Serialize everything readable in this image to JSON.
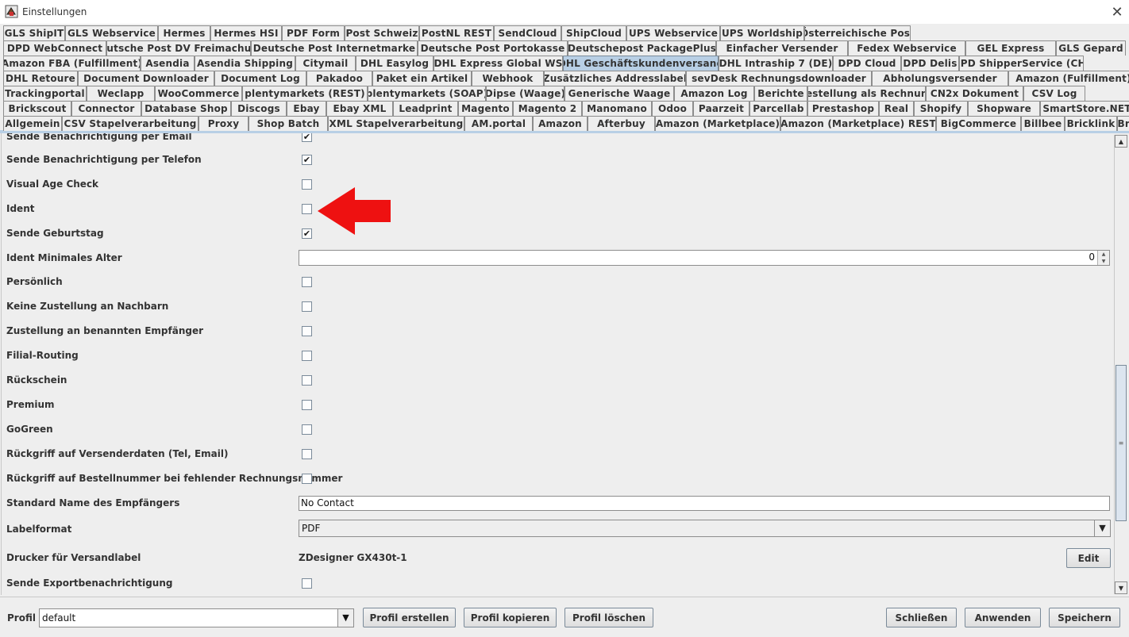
{
  "window": {
    "title": "Einstellungen",
    "close_glyph": "✕"
  },
  "tab_rows": [
    [
      "GLS ShipIT",
      "GLS Webservice",
      "Hermes",
      "Hermes HSI",
      "PDF Form",
      "Post Schweiz",
      "PostNL REST",
      "SendCloud",
      "ShipCloud",
      "UPS Webservice",
      "UPS Worldship",
      "Österreichische Post"
    ],
    [
      "DPD WebConnect",
      "Deutsche Post DV Freimachung",
      "Deutsche Post Internetmarke",
      "Deutsche Post Portokasse",
      "Deutschepost PackagePlus",
      "Einfacher Versender",
      "Fedex Webservice",
      "GEL Express",
      "GLS Gepard"
    ],
    [
      "Amazon FBA (Fulfillment)",
      "Asendia",
      "Asendia Shipping",
      "Citymail",
      "DHL Easylog",
      "DHL Express Global WS",
      "DHL Geschäftskundenversand",
      "DHL Intraship 7 (DE)",
      "DPD Cloud",
      "DPD Delis",
      "DPD ShipperService (CH)"
    ],
    [
      "DHL Retoure",
      "Document Downloader",
      "Document Log",
      "Pakadoo",
      "Paket ein Artikel",
      "Webhook",
      "Zusätzliches Addresslabel",
      "sevDesk Rechnungsdownloader",
      "Abholungsversender",
      "Amazon (Fulfillment)"
    ],
    [
      "Trackingportal",
      "Weclapp",
      "WooCommerce",
      "plentymarkets (REST)",
      "plentymarkets (SOAP)",
      "Dipse (Waage)",
      "Generische Waage",
      "Amazon Log",
      "Berichte",
      "Bestellung als Rechnung",
      "CN2x Dokument",
      "CSV Log"
    ],
    [
      "Brickscout",
      "Connector",
      "Database Shop",
      "Discogs",
      "Ebay",
      "Ebay XML",
      "Leadprint",
      "Magento",
      "Magento 2",
      "Manomano",
      "Odoo",
      "Paarzeit",
      "Parcellab",
      "Prestashop",
      "Real",
      "Shopify",
      "Shopware",
      "SmartStore.NET"
    ],
    [
      "Allgemein",
      "CSV Stapelverarbeitung",
      "Proxy",
      "Shop Batch",
      "XML Stapelverarbeitung",
      "AM.portal",
      "Amazon",
      "Afterbuy",
      "Amazon (Marketplace)",
      "Amazon (Marketplace) REST",
      "BigCommerce",
      "Billbee",
      "Bricklink",
      "Brickowl"
    ]
  ],
  "selected_tab": "DHL Geschäftskundenversand",
  "settings": {
    "r0": {
      "label": "Sende Benachrichtigung per Email",
      "checked": true
    },
    "r1": {
      "label": "Sende Benachrichtigung per Telefon",
      "checked": true
    },
    "r2": {
      "label": "Visual Age Check",
      "checked": false
    },
    "r3": {
      "label": "Ident",
      "checked": false
    },
    "r4": {
      "label": "Sende Geburtstag",
      "checked": true
    },
    "r5": {
      "label": "Ident Minimales Alter",
      "value": "0"
    },
    "r6": {
      "label": "Persönlich",
      "checked": false
    },
    "r7": {
      "label": "Keine Zustellung an Nachbarn",
      "checked": false
    },
    "r8": {
      "label": "Zustellung an benannten Empfänger",
      "checked": false
    },
    "r9": {
      "label": "Filial-Routing",
      "checked": false
    },
    "r10": {
      "label": "Rückschein",
      "checked": false
    },
    "r11": {
      "label": "Premium",
      "checked": false
    },
    "r12": {
      "label": "GoGreen",
      "checked": false
    },
    "r13": {
      "label": "Rückgriff auf Versenderdaten (Tel, Email)",
      "checked": false
    },
    "r14": {
      "label": "Rückgriff auf Bestellnummer bei fehlender Rechnungsnummer",
      "checked": false
    },
    "r15": {
      "label": "Standard Name des Empfängers",
      "value": "No Contact"
    },
    "r16": {
      "label": "Labelformat",
      "value": "PDF"
    },
    "r17": {
      "label": "Drucker für Versandlabel",
      "value": "ZDesigner GX430t-1",
      "button": "Edit"
    },
    "r18": {
      "label": "Sende Exportbenachrichtigung",
      "checked": false
    }
  },
  "check_glyph": "✔",
  "annotation_color": "#ee1111",
  "footer": {
    "profil_label": "Profil",
    "profil_value": "default",
    "btn_create": "Profil erstellen",
    "btn_copy": "Profil kopieren",
    "btn_delete": "Profil löschen",
    "btn_close": "Schließen",
    "btn_apply": "Anwenden",
    "btn_save": "Speichern"
  }
}
